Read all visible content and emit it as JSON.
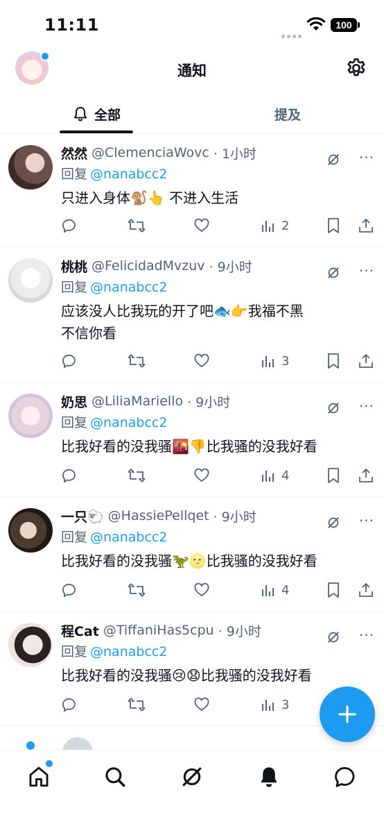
{
  "status_bar": {
    "time": "11:11",
    "battery": "100"
  },
  "header": {
    "title": "通知"
  },
  "tabs": {
    "all": "全部",
    "mentions": "提及"
  },
  "posts": [
    {
      "name": "然然",
      "handle": "@ClemenciaWovc",
      "time": "· 1小时",
      "reply_prefix": "回复",
      "reply_to": "@nanabcc2",
      "text": "只进入身体🐒👆 不进入生活",
      "views": "2"
    },
    {
      "name": "桃桃",
      "handle": "@FelicidadMvzuv",
      "time": "· 9小时",
      "reply_prefix": "回复",
      "reply_to": "@nanabcc2",
      "text": "应该没人比我玩的开了吧🐟👉我福不黑\n不信你看",
      "views": "3"
    },
    {
      "name": "奶思",
      "handle": "@LiliaMariello",
      "time": "· 9小时",
      "reply_prefix": "回复",
      "reply_to": "@nanabcc2",
      "text": "比我好看的没我骚🌇👎比我骚的没我好看",
      "views": "4"
    },
    {
      "name": "一只🐑",
      "handle": "@HassiePellqet",
      "time": "· 9小时",
      "reply_prefix": "回复",
      "reply_to": "@nanabcc2",
      "text": "比我好看的没我骚🦖🌝比我骚的没我好看",
      "views": "4"
    },
    {
      "name": "程Cat",
      "handle": "@TiffaniHas5cpu",
      "time": "· 9小时",
      "reply_prefix": "回复",
      "reply_to": "@nanabcc2",
      "text": "比我好看的没我骚😢😧比我骚的没我好看",
      "views": "3"
    }
  ],
  "more_label": "···",
  "colors": {
    "accent": "#1d9bf0",
    "text": "#0f1419",
    "muted": "#536471"
  },
  "icons": [
    "reply-icon",
    "retweet-icon",
    "like-icon",
    "views-icon",
    "bookmark-icon",
    "share-icon",
    "grok-icon",
    "gear-icon",
    "bell-icon",
    "home-icon",
    "search-icon",
    "compose-icon"
  ]
}
